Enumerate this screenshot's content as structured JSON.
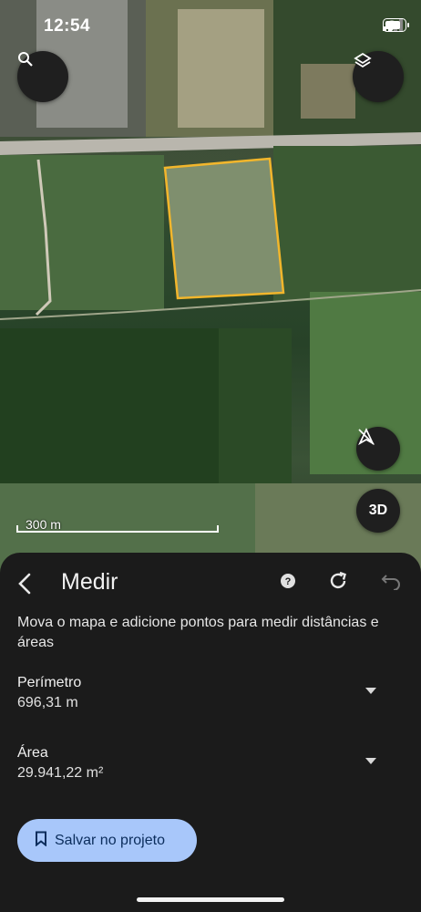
{
  "status_bar": {
    "time": "12:54"
  },
  "map": {
    "scale_label": "300 m",
    "buttons": [
      "search-icon",
      "layers-icon",
      "compass-north-icon",
      "3d-toggle"
    ],
    "three_d_label": "3D",
    "highlight_color": "#f2b62c"
  },
  "sheet": {
    "title": "Medir",
    "instructions": "Mova o mapa e adicione pontos para medir distâncias e áreas",
    "perimeter": {
      "label": "Perímetro",
      "value": "696,31 m"
    },
    "area": {
      "label": "Área",
      "value": "29.941,22 m²"
    },
    "save_label": "Salvar no projeto",
    "accent": "#a8c7fa"
  }
}
